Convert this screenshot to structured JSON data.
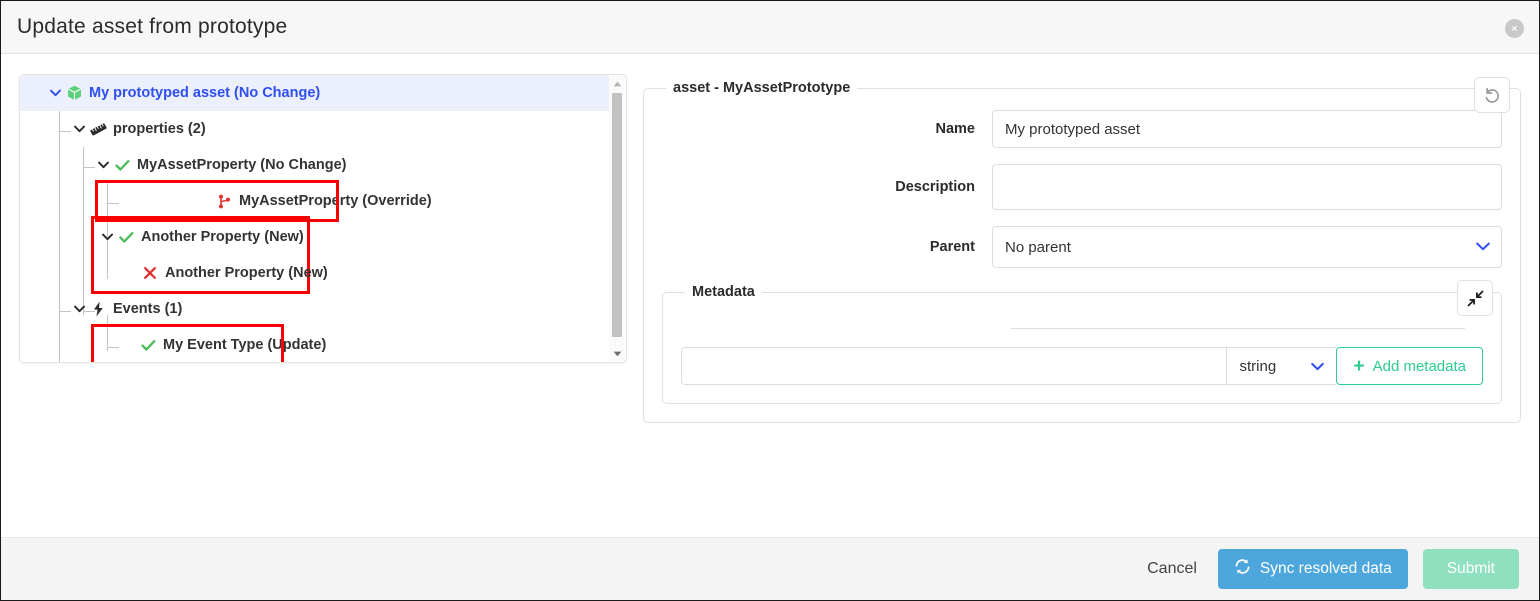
{
  "dialog": {
    "title": "Update asset from prototype",
    "close_icon": "close-circle-icon"
  },
  "tree": {
    "nodes": [
      {
        "label": "My prototyped asset (No Change)",
        "icon": "cube-icon",
        "depth": 0,
        "expanded": true,
        "selected": true,
        "highlighted": false
      },
      {
        "label": "properties (2)",
        "icon": "ruler-icon",
        "depth": 1,
        "expanded": true,
        "selected": false,
        "highlighted": false
      },
      {
        "label": "MyAssetProperty (No Change)",
        "icon": "check-icon",
        "depth": 2,
        "expanded": true,
        "selected": false,
        "highlighted": false
      },
      {
        "label": "MyAssetProperty (Override)",
        "icon": "branch-icon",
        "depth": 3,
        "expanded": false,
        "selected": false,
        "highlighted": true
      },
      {
        "label": "Another Property (New)",
        "icon": "check-icon",
        "depth": 2,
        "expanded": true,
        "selected": false,
        "highlighted": false
      },
      {
        "label": "Another Property (New)",
        "icon": "cross-icon",
        "depth": 3,
        "expanded": false,
        "selected": false,
        "highlighted": false
      },
      {
        "label": "Events (1)",
        "icon": "bolt-icon",
        "depth": 1,
        "expanded": true,
        "selected": false,
        "highlighted": false
      },
      {
        "label": "My Event Type (Update)",
        "icon": "check-icon",
        "depth": 2,
        "expanded": false,
        "selected": false,
        "highlighted": true
      }
    ],
    "scrollbar": {
      "up_arrow_icon": "caret-up-icon",
      "down_arrow_icon": "caret-down-icon"
    }
  },
  "asset_form": {
    "legend": "asset - MyAssetPrototype",
    "revert_icon": "undo-icon",
    "fields": [
      {
        "label": "Name",
        "value": "My prototyped asset",
        "placeholder": "",
        "type": "text"
      },
      {
        "label": "Description",
        "value": "",
        "placeholder": "",
        "type": "text"
      },
      {
        "label": "Parent",
        "value": "No parent",
        "placeholder": "",
        "type": "select"
      }
    ]
  },
  "metadata": {
    "legend": "Metadata",
    "collapse_icon": "compress-icon",
    "key_value": "",
    "key_placeholder": "",
    "type_value": "string",
    "type_chevron_icon": "chevron-down-icon",
    "add_label": "Add metadata",
    "add_plus_icon": "plus-icon"
  },
  "footer": {
    "cancel_label": "Cancel",
    "sync_label": "Sync resolved data",
    "sync_icon": "sync-icon",
    "submit_label": "Submit"
  },
  "colors": {
    "accent_blue": "#4da7dd",
    "accent_green": "#2ecc8f",
    "submit_disabled": "#8fe0bf",
    "highlight_red": "#fb0000",
    "tree_selected_text": "#2f4ff0",
    "tree_selected_bg": "#eceffc"
  }
}
